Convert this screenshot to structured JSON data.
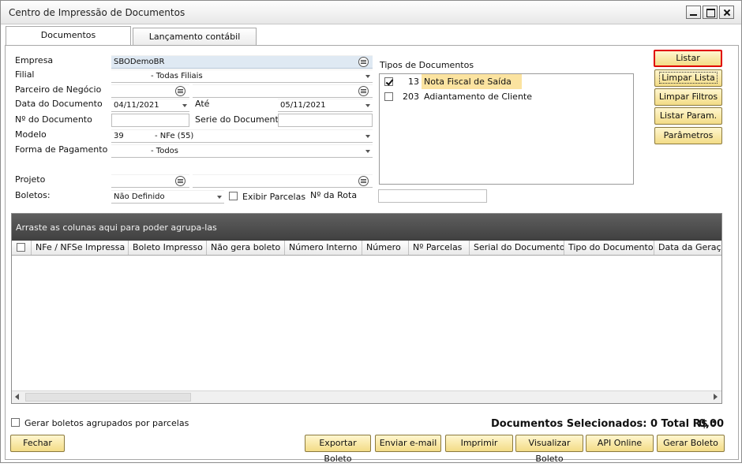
{
  "window": {
    "title": "Centro de Impressão de Documentos"
  },
  "tabs": [
    {
      "label": "Documentos"
    },
    {
      "label": "Lançamento contábil manual"
    }
  ],
  "form": {
    "empresa_label": "Empresa",
    "empresa_value": "SBODemoBR",
    "filial_label": "Filial",
    "filial_value": "- Todas Filiais",
    "parceiro_label": "Parceiro de Negócio",
    "parceiro_value": "",
    "data_doc_label": "Data do Documento",
    "data_doc_from": "04/11/2021",
    "ate_label": "Até",
    "data_doc_to": "05/11/2021",
    "num_doc_label": "Nº do Documento",
    "num_doc_value": "",
    "serie_label": "Serie do Documento",
    "serie_value": "",
    "modelo_label": "Modelo",
    "modelo_code": "39",
    "modelo_value": "- NFe (55)",
    "forma_pag_label": "Forma de Pagamento",
    "forma_pag_value": "- Todos",
    "projeto_label": "Projeto",
    "boletos_label": "Boletos:",
    "boletos_value": "Não Definido",
    "exibir_parcelas_label": "Exibir Parcelas",
    "num_rota_label": "Nº da Rota"
  },
  "tipos_documentos": {
    "label": "Tipos de Documentos",
    "items": [
      {
        "code": "13",
        "name": "Nota Fiscal de Saída",
        "checked": true
      },
      {
        "code": "203",
        "name": "Adiantamento de Cliente",
        "checked": false
      }
    ]
  },
  "side_buttons": {
    "listar": "Listar",
    "limpar_lista": "Limpar Lista",
    "limpar_filtros": "Limpar Filtros",
    "listar_param": "Listar Param.",
    "parametros": "Parâmetros"
  },
  "grid": {
    "group_hint": "Arraste as colunas aqui para poder agrupa-las",
    "columns": [
      "NFe / NFSe Impressa",
      "Boleto Impresso",
      "Não gera boleto",
      "Número Interno",
      "Número",
      "Nº Parcelas",
      "Serial do Documento",
      "Tipo do Documento",
      "Data da Geração"
    ]
  },
  "footer": {
    "gerar_agrupados_label": "Gerar boletos agrupados por parcelas",
    "total_label": "Documentos Selecionados: 0 Total R$ :",
    "total_value": "0,00",
    "fechar": "Fechar",
    "exportar_boleto": "Exportar Boleto",
    "enviar_email": "Enviar e-mail",
    "imprimir": "Imprimir",
    "visualizar_boleto": "Visualizar Boleto",
    "api_online": "API Online",
    "gerar_boleto": "Gerar Boleto"
  },
  "colors": {
    "accent_button": "#f3dc86",
    "highlight_border": "#e00000",
    "selected_row": "#fbe3a0",
    "group_header": "#4f4f4f"
  }
}
